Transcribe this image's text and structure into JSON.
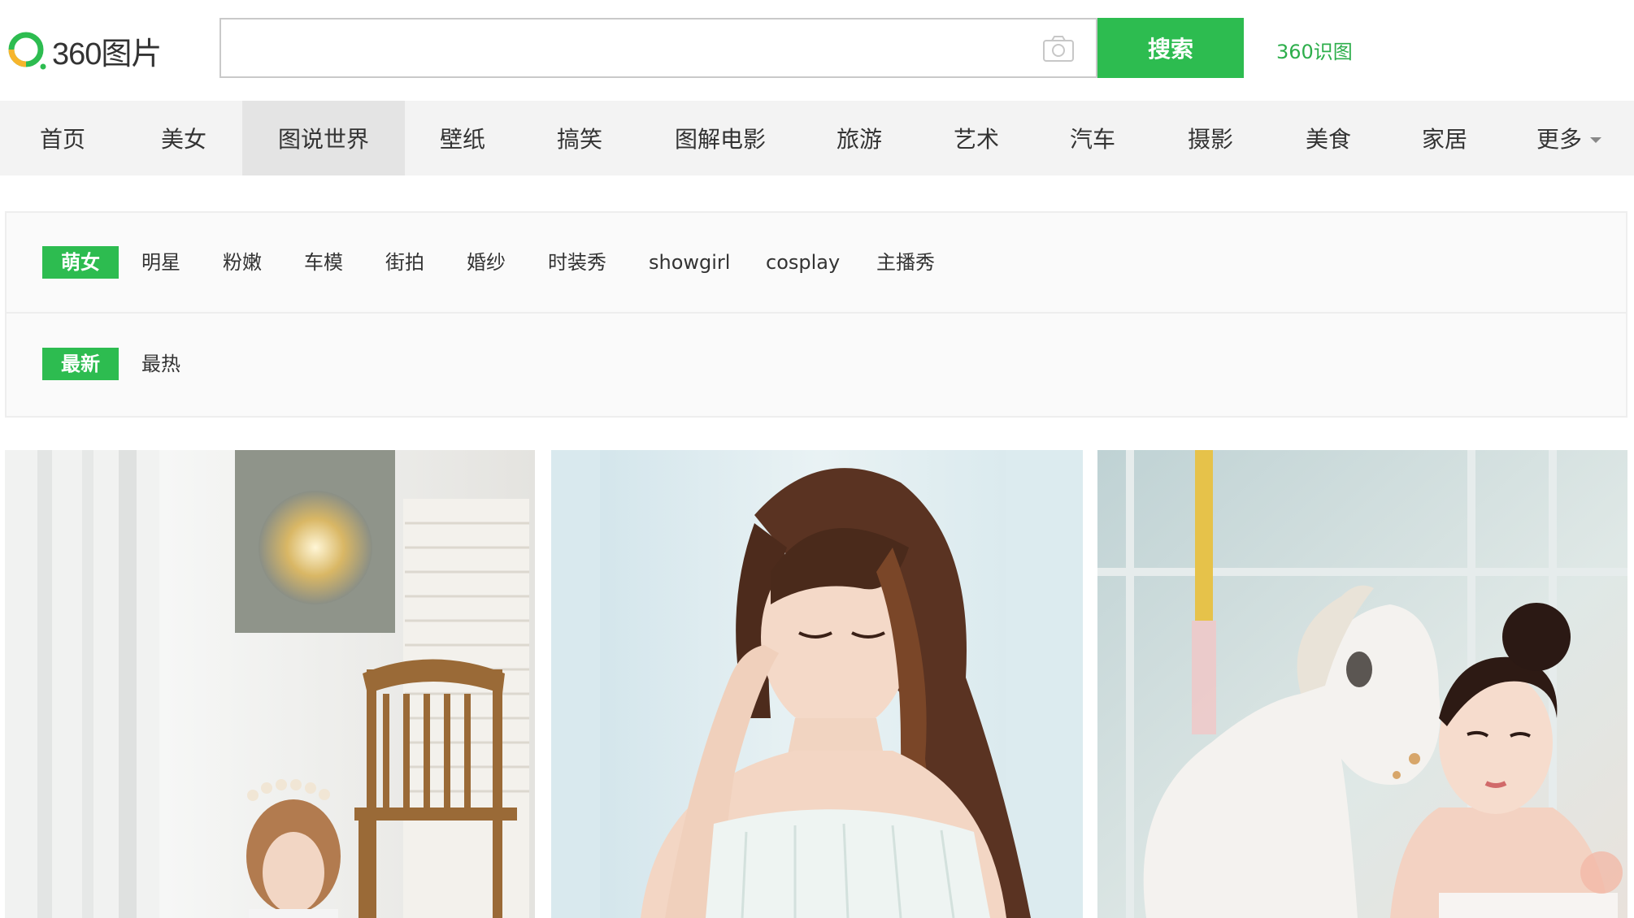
{
  "logo": {
    "text": "360图片"
  },
  "search": {
    "placeholder": "",
    "button_label": "搜索",
    "shitu_label": "360识图"
  },
  "nav": {
    "items": [
      {
        "label": "首页"
      },
      {
        "label": "美女"
      },
      {
        "label": "图说世界"
      },
      {
        "label": "壁纸"
      },
      {
        "label": "搞笑"
      },
      {
        "label": "图解电影"
      },
      {
        "label": "旅游"
      },
      {
        "label": "艺术"
      },
      {
        "label": "汽车"
      },
      {
        "label": "摄影"
      },
      {
        "label": "美食"
      },
      {
        "label": "家居"
      },
      {
        "label": "更多"
      }
    ],
    "active": "美女"
  },
  "filters": {
    "categories": [
      {
        "label": "萌女",
        "active": true
      },
      {
        "label": "明星"
      },
      {
        "label": "粉嫩"
      },
      {
        "label": "车模"
      },
      {
        "label": "街拍"
      },
      {
        "label": "婚纱"
      },
      {
        "label": "时装秀"
      },
      {
        "label": "showgirl"
      },
      {
        "label": "cosplay"
      },
      {
        "label": "主播秀"
      }
    ],
    "sort": [
      {
        "label": "最新",
        "active": true
      },
      {
        "label": "最热"
      }
    ]
  },
  "colors": {
    "accent": "#2dbc50",
    "link": "#2dae4b",
    "nav_bg": "#f3f3f3",
    "nav_active_bg": "#e4e4e4"
  },
  "images": [
    {
      "subject": "girl-with-flower-crown-and-wooden-chair"
    },
    {
      "subject": "girl-in-white-dress-touching-hair"
    },
    {
      "subject": "girl-with-white-carousel-horse"
    }
  ]
}
